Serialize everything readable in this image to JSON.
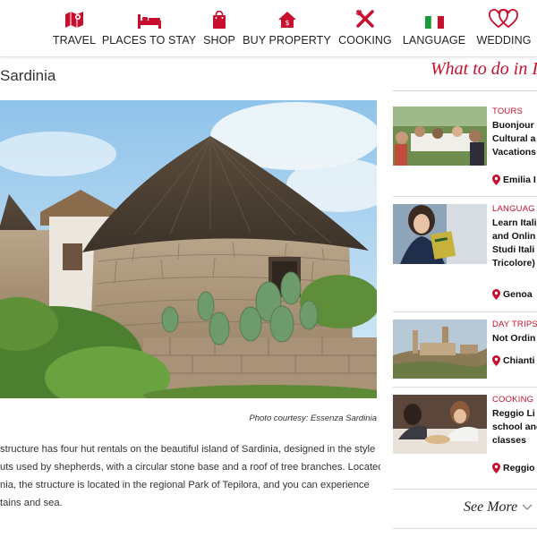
{
  "nav": {
    "items": [
      {
        "label": "TRAVEL",
        "icon": "map-icon"
      },
      {
        "label": "PLACES TO STAY",
        "icon": "bed-icon"
      },
      {
        "label": "SHOP",
        "icon": "shopping-bag-icon"
      },
      {
        "label": "BUY PROPERTY",
        "icon": "house-icon"
      },
      {
        "label": "COOKING",
        "icon": "fork-knife-icon"
      },
      {
        "label": "LANGUAGE",
        "icon": "italian-flag-icon"
      },
      {
        "label": "WEDDING",
        "icon": "hearts-icon"
      }
    ],
    "accent_color": "#c8102e"
  },
  "article": {
    "title": "Sardinia",
    "photo_caption": "Photo courtesy: Essenza Sardinia",
    "body_lines": [
      "structure has four hut rentals on the beautiful island of Sardinia, designed in the style",
      "uts used by shepherds, with a circular stone base and a roof of tree branches. Located",
      "nia, the structure is located in the regional Park of Tepilora, and you can experience",
      "tains and sea."
    ]
  },
  "sidebar": {
    "title": "What to do in I",
    "cards": [
      {
        "category": "TOURS",
        "title_lines": [
          "Buonjour",
          "Cultural a",
          "Vacations"
        ],
        "location": "Emilia I"
      },
      {
        "category": "LANGUAG",
        "title_lines": [
          "Learn Itali",
          "and Onlin",
          "Studi Itali",
          "Tricolore)"
        ],
        "location": "Genoa"
      },
      {
        "category": "DAY TRIPS",
        "title_lines": [
          "Not Ordin"
        ],
        "location": "Chianti"
      },
      {
        "category": "COOKING",
        "title_lines": [
          "Reggio Li",
          "school and",
          "classes"
        ],
        "location": "Reggio"
      }
    ],
    "see_more": "See More"
  }
}
